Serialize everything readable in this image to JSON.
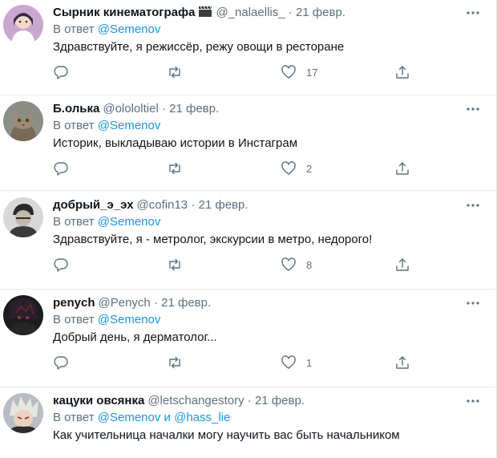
{
  "reply_prefix": "В ответ",
  "and_word": "и",
  "tweets": [
    {
      "name": "Сырник кинематографа",
      "handle": "@_nalaellis_",
      "dot": "·",
      "date": "21 февр.",
      "mention": "@Semenov",
      "mention2": "",
      "text": "Здравствуйте, я режиссёр, режу овощи в ресторане",
      "likes": "17",
      "emoji": "clapper-board-icon"
    },
    {
      "name": "Б.олька",
      "handle": "@olololtiel",
      "dot": "·",
      "date": "21 февр.",
      "mention": "@Semenov",
      "mention2": "",
      "text": "Историк, выкладываю истории в Инстаграм",
      "likes": "2"
    },
    {
      "name": "добрый_э_эх",
      "handle": "@cofin13",
      "dot": "·",
      "date": "21 февр.",
      "mention": "@Semenov",
      "mention2": "",
      "text": "Здравствуйте, я - метролог, экскурсии в метро, недорого!",
      "likes": "8"
    },
    {
      "name": "penych",
      "handle": "@Penych",
      "dot": "·",
      "date": "21 февр.",
      "mention": "@Semenov",
      "mention2": "",
      "text": "Добрый день, я дерматолог...",
      "likes": "1"
    },
    {
      "name": "кацуки овсянка",
      "handle": "@letschangestory",
      "dot": "·",
      "date": "21 февр.",
      "mention": "@Semenov",
      "mention2": "@hass_lie",
      "text": "Как учительница началки могу научить вас быть начальником",
      "likes": ""
    }
  ],
  "colors": {
    "link": "#1b95e0",
    "secondary": "#5b7083",
    "primary": "#0f1419",
    "divider": "#e6ecf0"
  }
}
